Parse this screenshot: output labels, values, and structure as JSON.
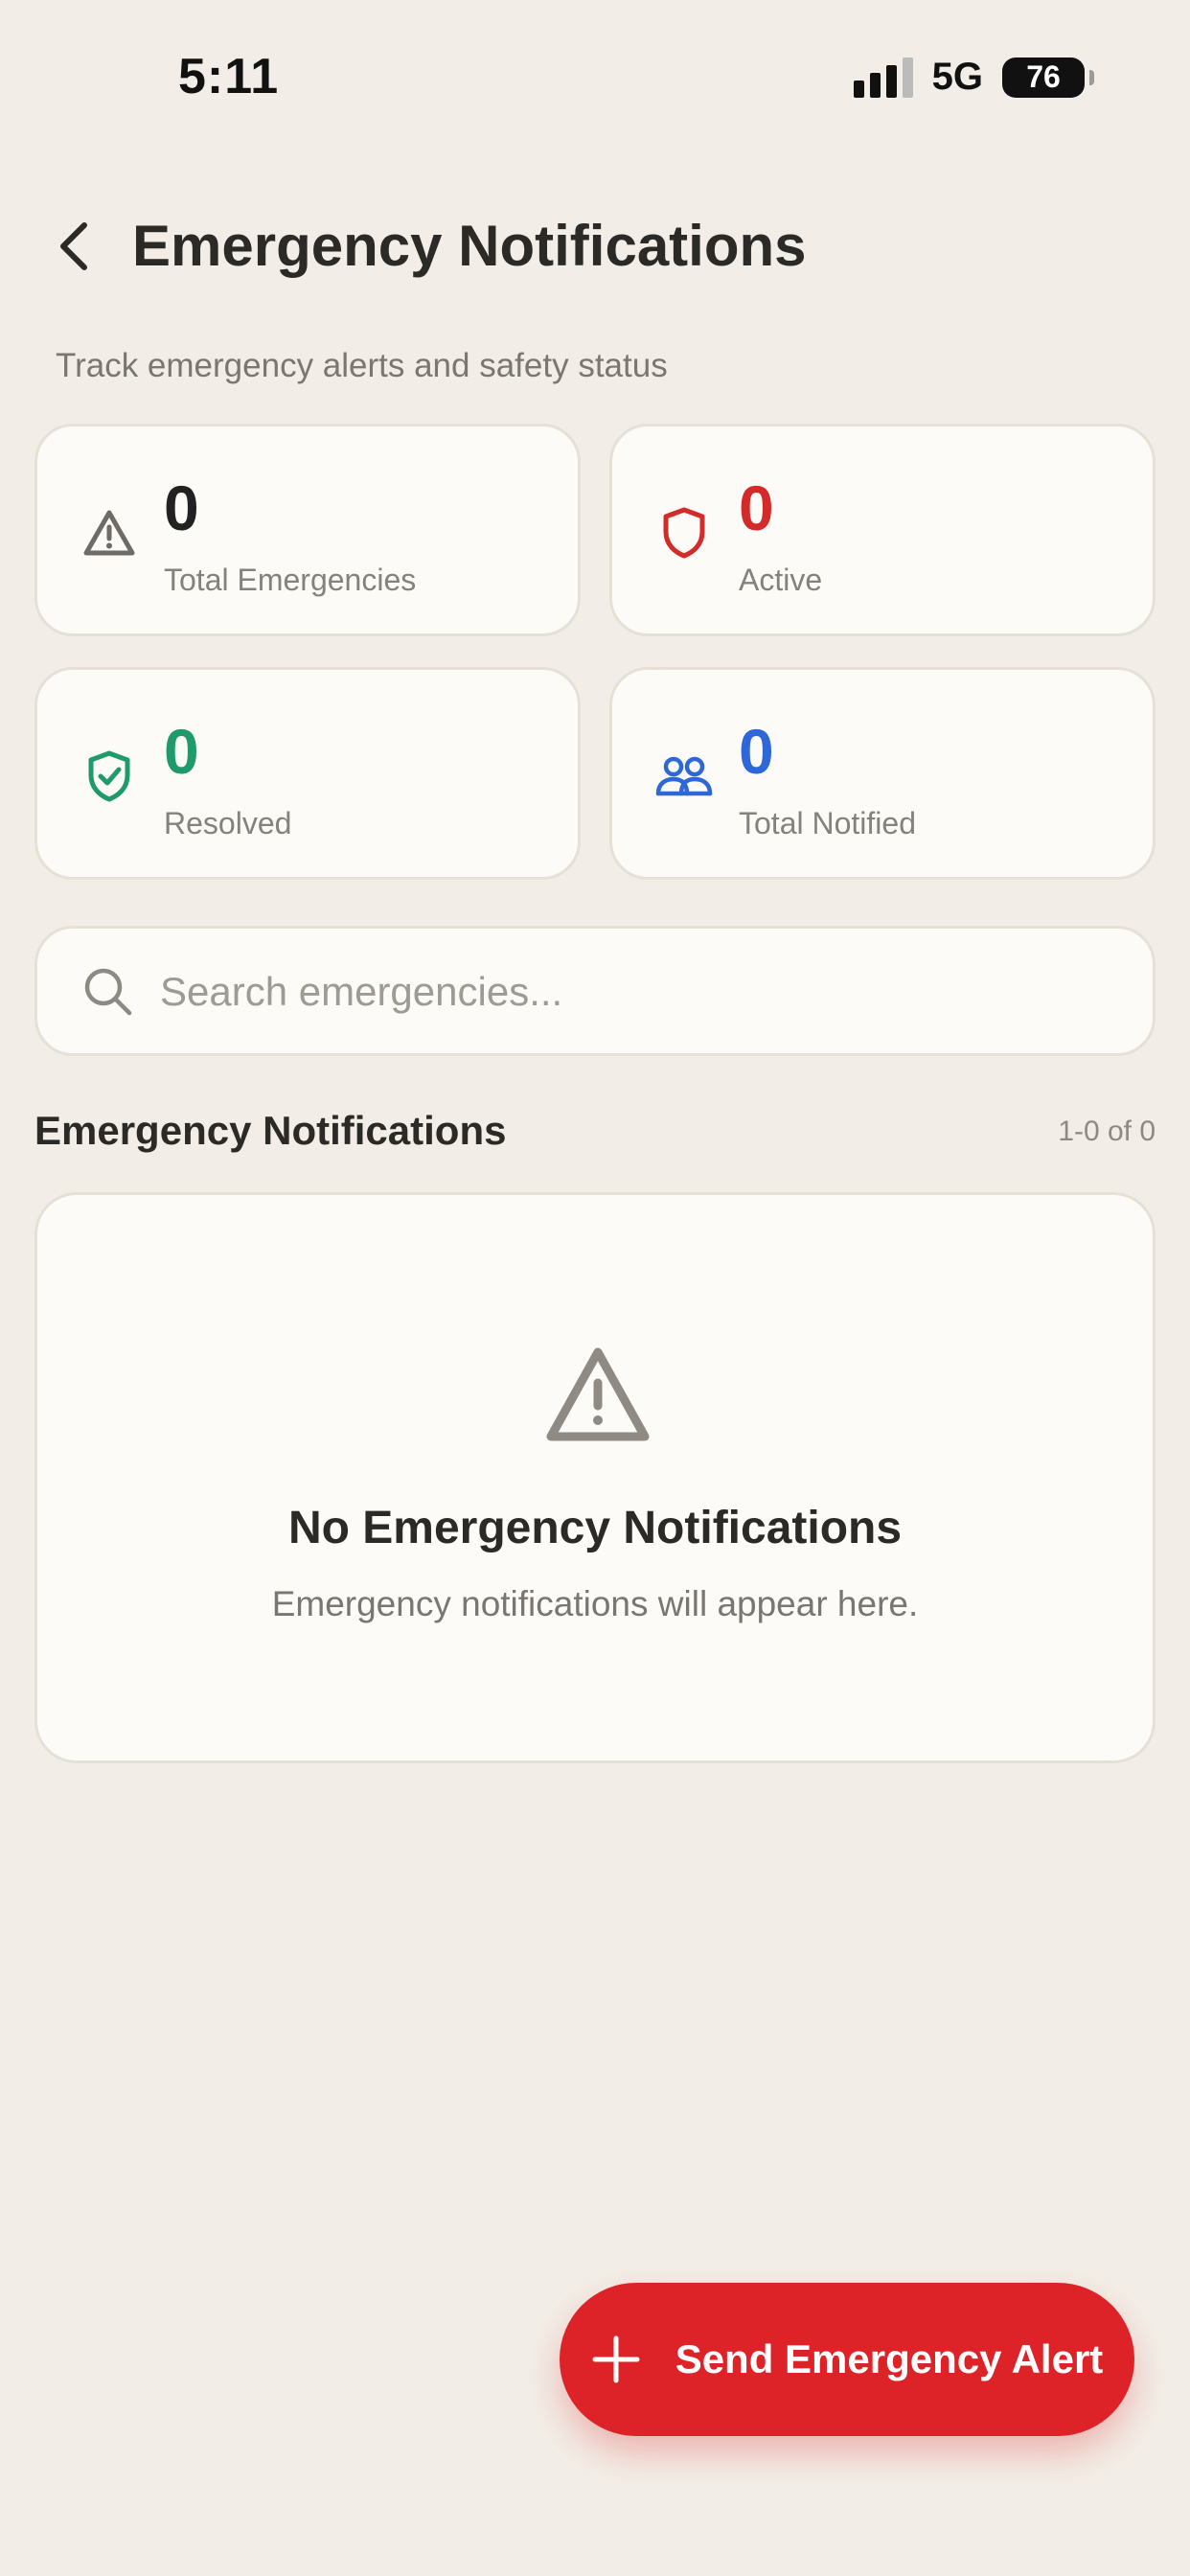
{
  "status_bar": {
    "time": "5:11",
    "network": "5G",
    "battery": "76"
  },
  "header": {
    "title": "Emergency Notifications",
    "subtitle": "Track emergency alerts and safety status"
  },
  "stats": [
    {
      "value": "0",
      "label": "Total Emergencies",
      "color": "#222222",
      "icon": "warning-triangle-icon"
    },
    {
      "value": "0",
      "label": "Active",
      "color": "#d32a2a",
      "icon": "shield-icon"
    },
    {
      "value": "0",
      "label": "Resolved",
      "color": "#1f9a6a",
      "icon": "shield-check-icon"
    },
    {
      "value": "0",
      "label": "Total Notified",
      "color": "#2d67d8",
      "icon": "users-icon"
    }
  ],
  "search": {
    "placeholder": "Search emergencies..."
  },
  "list": {
    "title": "Emergency Notifications",
    "count": "1-0 of 0"
  },
  "empty_state": {
    "title": "No Emergency Notifications",
    "description": "Emergency notifications will appear here."
  },
  "fab": {
    "label": "Send Emergency Alert"
  },
  "colors": {
    "background": "#f2eee7",
    "card": "#fcfbf7",
    "accent_red": "#dd2327"
  }
}
